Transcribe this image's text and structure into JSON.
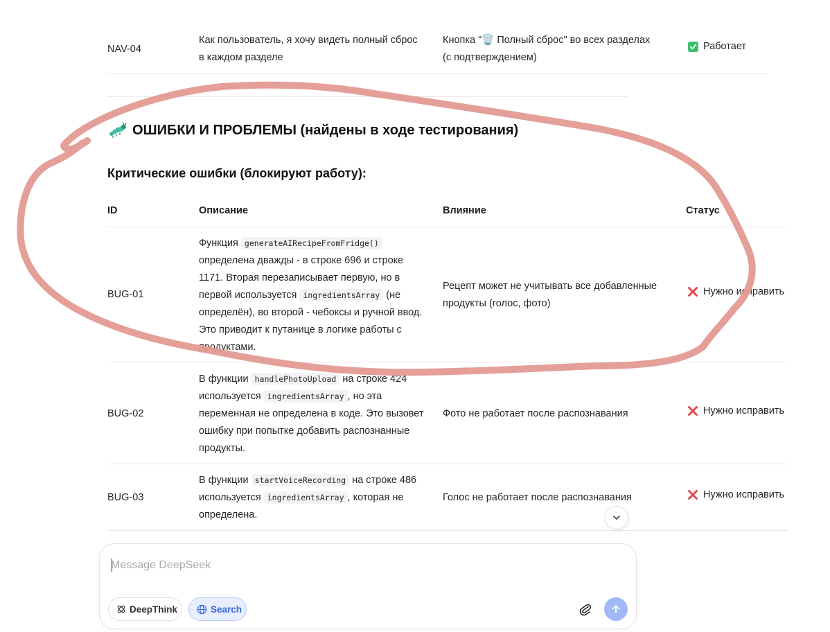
{
  "nav_row": {
    "id": "NAV-04",
    "description": "Как пользователь, я хочу видеть полный сброс в каждом разделе",
    "implementation_line1": "Кнопка \"🗑️ Полный сброс\" во всех разделах",
    "implementation_line2": "(с подтверждением)",
    "status": "Работает"
  },
  "section": {
    "icon": "bug-icon",
    "title": "ОШИБКИ И ПРОБЛЕМЫ (найдены в ходе тестирования)"
  },
  "critical": {
    "subtitle": "Критические ошибки (блокируют работу):",
    "headers": {
      "id": "ID",
      "description": "Описание",
      "impact": "Влияние",
      "status": "Статус"
    }
  },
  "bugs": [
    {
      "id": "BUG-01",
      "d1": "Функция ",
      "c1": "generateAIRecipeFromFridge()",
      "d2": " определена дважды - в строке 696 и строке 1171. Вторая перезаписывает первую, но в первой используется ",
      "c2": "ingredientsArray",
      "d3": " (не определён), во второй - чебоксы и ручной ввод. Это приводит к путанице в логике работы с продуктами.",
      "impact": "Рецепт может не учитывать все добавленные продукты (голос, фото)",
      "status": "Нужно исправить"
    },
    {
      "id": "BUG-02",
      "d1": "В функции ",
      "c1": "handlePhotoUpload",
      "d2": " на строке 424 используется ",
      "c2": "ingredientsArray",
      "d3": ", но эта переменная не определена в коде. Это вызовет ошибку при попытке добавить распознанные продукты.",
      "impact": "Фото не работает после распознавания",
      "status": "Нужно исправить"
    },
    {
      "id": "BUG-03",
      "d1": "В функции ",
      "c1": "startVoiceRecording",
      "d2": " на строке 486 используется ",
      "c2": "ingredientsArray",
      "d3": ", которая не определена.",
      "impact": "Голос не работает после распознавания",
      "status": "Нужно исправить"
    }
  ],
  "composer": {
    "placeholder": "Message DeepSeek",
    "deepthink_label": "DeepThink",
    "search_label": "Search"
  },
  "colors": {
    "annotation": "#e39a92",
    "success": "#3fbf6b",
    "error": "#e5484d",
    "send": "#a3b8f6",
    "search_pill": "#e7eefd"
  }
}
